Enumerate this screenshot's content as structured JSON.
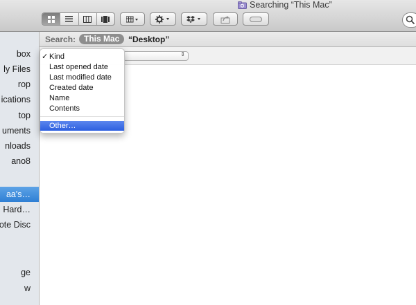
{
  "window": {
    "title": "Searching “This Mac”"
  },
  "toolbar": {
    "view_buttons": [
      "icon-view",
      "list-view",
      "column-view",
      "cover-flow-view"
    ],
    "active_view": "icon-view"
  },
  "sidebar": {
    "items": [
      {
        "label": "box",
        "selected": false
      },
      {
        "label": "ly Files",
        "selected": false
      },
      {
        "label": "rop",
        "selected": false
      },
      {
        "label": "ications",
        "selected": false
      },
      {
        "label": "top",
        "selected": false
      },
      {
        "label": "uments",
        "selected": false
      },
      {
        "label": "nloads",
        "selected": false
      },
      {
        "label": "ano8",
        "selected": false
      },
      {
        "label": "aa's…",
        "selected": true
      },
      {
        "label": "Hard…",
        "selected": false
      },
      {
        "label": "ote Disc",
        "selected": false
      },
      {
        "label": "ge",
        "selected": false
      },
      {
        "label": "w",
        "selected": false
      }
    ]
  },
  "search": {
    "label": "Search:",
    "scope_active": "This Mac",
    "scope_other": "“Desktop”"
  },
  "menu": {
    "items": [
      {
        "label": "Kind",
        "checked": true
      },
      {
        "label": "Last opened date",
        "checked": false
      },
      {
        "label": "Last modified date",
        "checked": false
      },
      {
        "label": "Created date",
        "checked": false
      },
      {
        "label": "Name",
        "checked": false
      },
      {
        "label": "Contents",
        "checked": false
      }
    ],
    "other_label": "Other…",
    "check_glyph": "✓"
  },
  "colors": {
    "selection_blue": "#2f7fd4",
    "menu_highlight": "#2c5fe0",
    "scope_pill": "#8e8e8e"
  }
}
